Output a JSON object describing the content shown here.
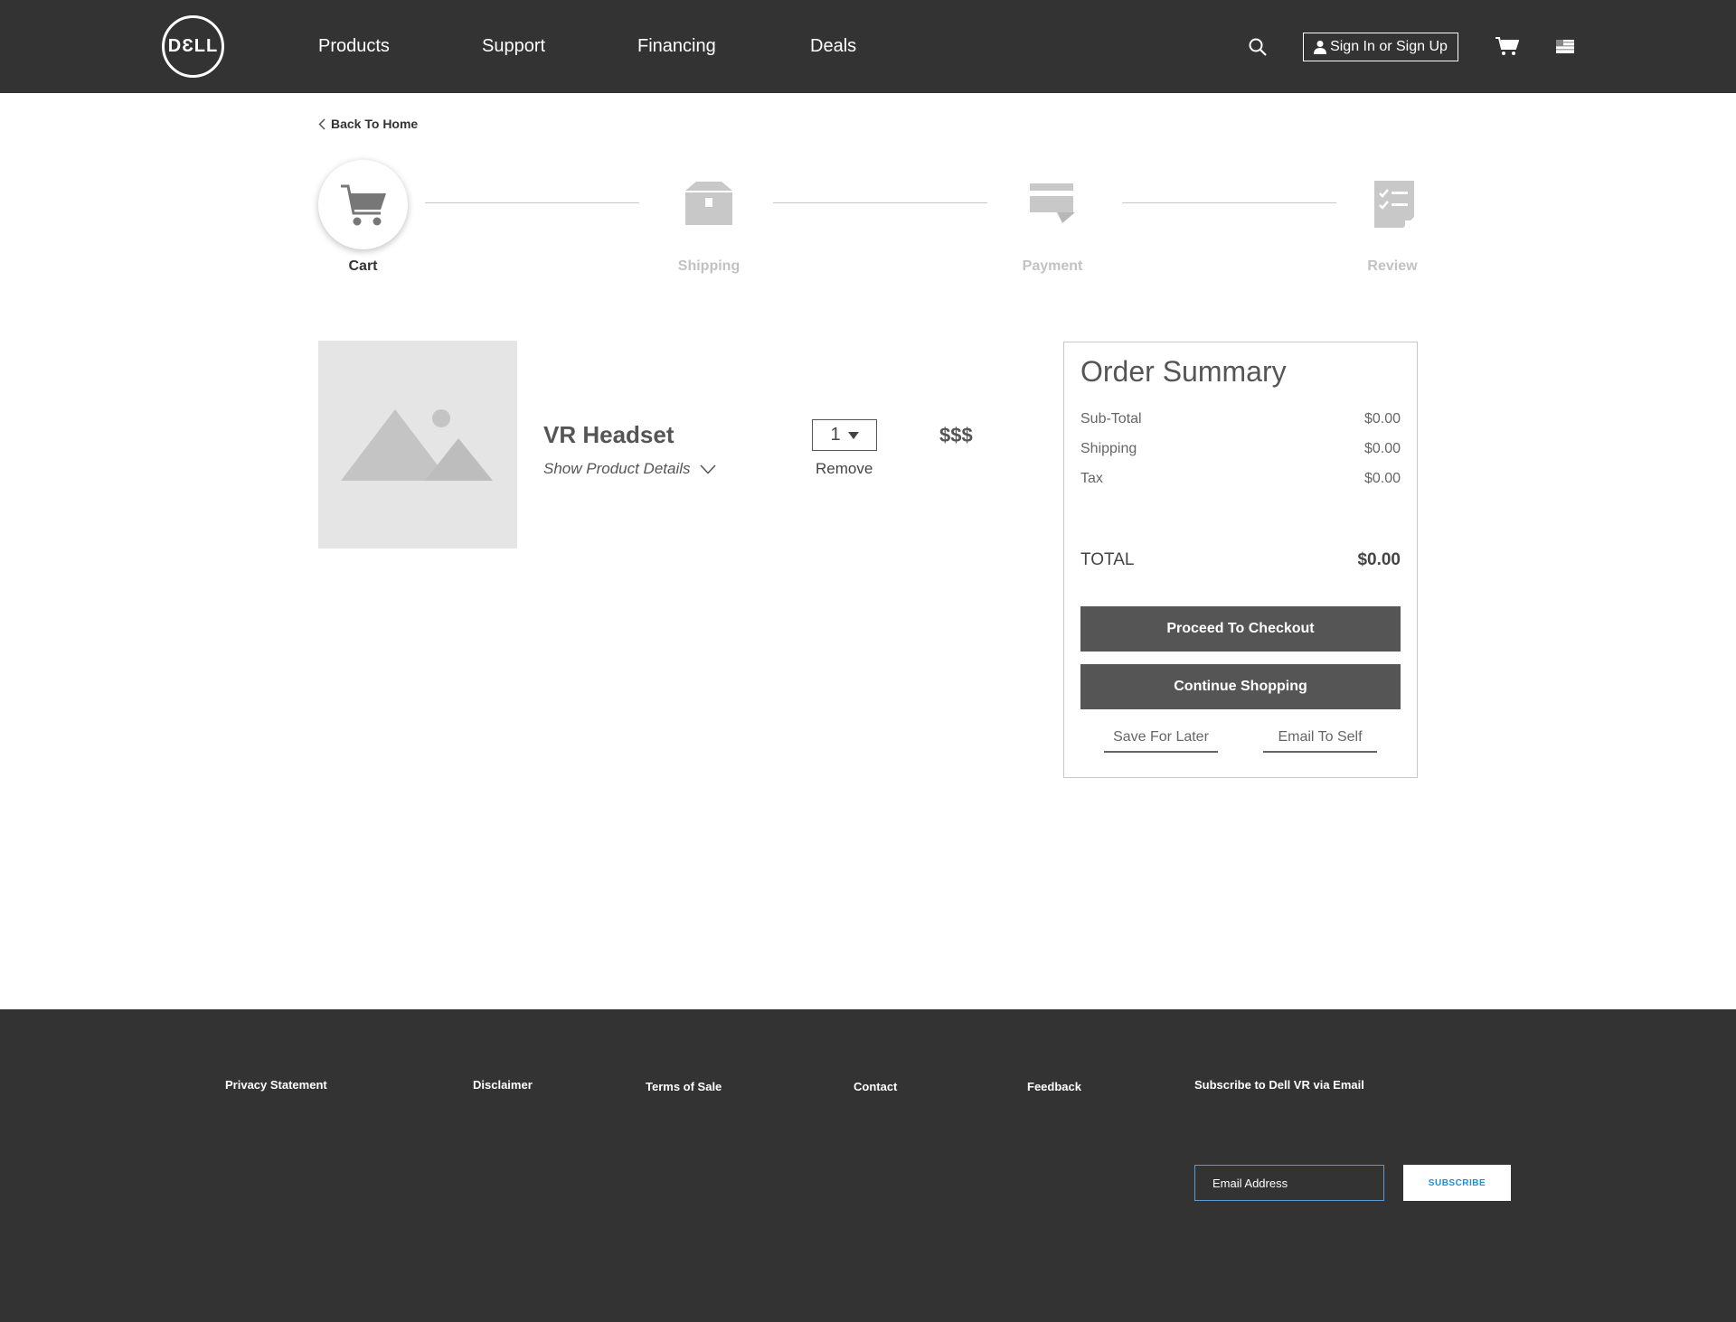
{
  "header": {
    "logo": "DƐLL",
    "nav": [
      "Products",
      "Support",
      "Financing",
      "Deals"
    ],
    "signin_label": "Sign In or Sign Up"
  },
  "back_label": "Back To Home",
  "steps": [
    "Cart",
    "Shipping",
    "Payment",
    "Review"
  ],
  "product": {
    "name": "VR Headset",
    "details_label": "Show Product Details",
    "quantity": "1",
    "remove_label": "Remove",
    "price": "$$$"
  },
  "summary": {
    "title": "Order Summary",
    "rows": [
      {
        "label": "Sub-Total",
        "value": "$0.00"
      },
      {
        "label": "Shipping",
        "value": "$0.00"
      },
      {
        "label": "Tax",
        "value": "$0.00"
      }
    ],
    "total_label": "TOTAL",
    "total_value": "$0.00",
    "checkout_label": "Proceed To Checkout",
    "continue_label": "Continue Shopping",
    "save_label": "Save For Later",
    "email_label": "Email To Self"
  },
  "footer": {
    "links": [
      "Privacy Statement",
      "Disclaimer",
      "Terms of Sale",
      "Contact",
      "Feedback"
    ],
    "subscribe_heading": "Subscribe to Dell VR via Email",
    "email_placeholder": "Email Address",
    "subscribe_label": "SUBSCRIBE"
  },
  "colors": {
    "header_bg": "#333333",
    "button_dark": "#555555",
    "subscribe_text": "#1a8fd9",
    "inactive_step": "#c2c2c2"
  },
  "icons": [
    "dell-logo",
    "search-icon",
    "user-icon",
    "cart-icon",
    "flag-icon",
    "chevron-left-icon",
    "box-icon",
    "credit-card-icon",
    "checklist-icon",
    "image-placeholder-icon",
    "chevron-down-icon",
    "caret-down-icon"
  ]
}
